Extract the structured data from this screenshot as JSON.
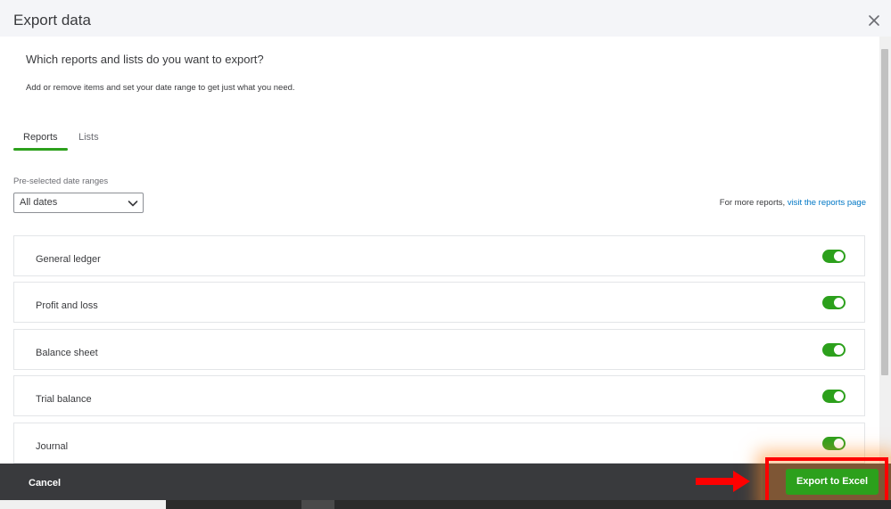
{
  "modal": {
    "title": "Export data",
    "question": "Which reports and lists do you want to export?",
    "subtitle": "Add or remove items and set your date range to get just what you need."
  },
  "tabs": [
    {
      "label": "Reports",
      "active": true
    },
    {
      "label": "Lists",
      "active": false
    }
  ],
  "date_range": {
    "label": "Pre-selected date ranges",
    "selected": "All dates"
  },
  "more_reports": {
    "prefix": "For more reports, ",
    "link": "visit the reports page"
  },
  "reports": [
    {
      "label": "General ledger",
      "enabled": true
    },
    {
      "label": "Profit and loss",
      "enabled": true
    },
    {
      "label": "Balance sheet",
      "enabled": true
    },
    {
      "label": "Trial balance",
      "enabled": true
    },
    {
      "label": "Journal",
      "enabled": true
    }
  ],
  "footer": {
    "cancel_label": "Cancel",
    "export_label": "Export to Excel"
  },
  "icons": {
    "close": "close-icon",
    "chevron": "chevron-down-icon",
    "annotation_arrow": "red-arrow-icon"
  },
  "colors": {
    "accent": "#2ca01c",
    "link": "#0077c5",
    "footer": "#393a3d",
    "annotation": "#ff0000"
  }
}
